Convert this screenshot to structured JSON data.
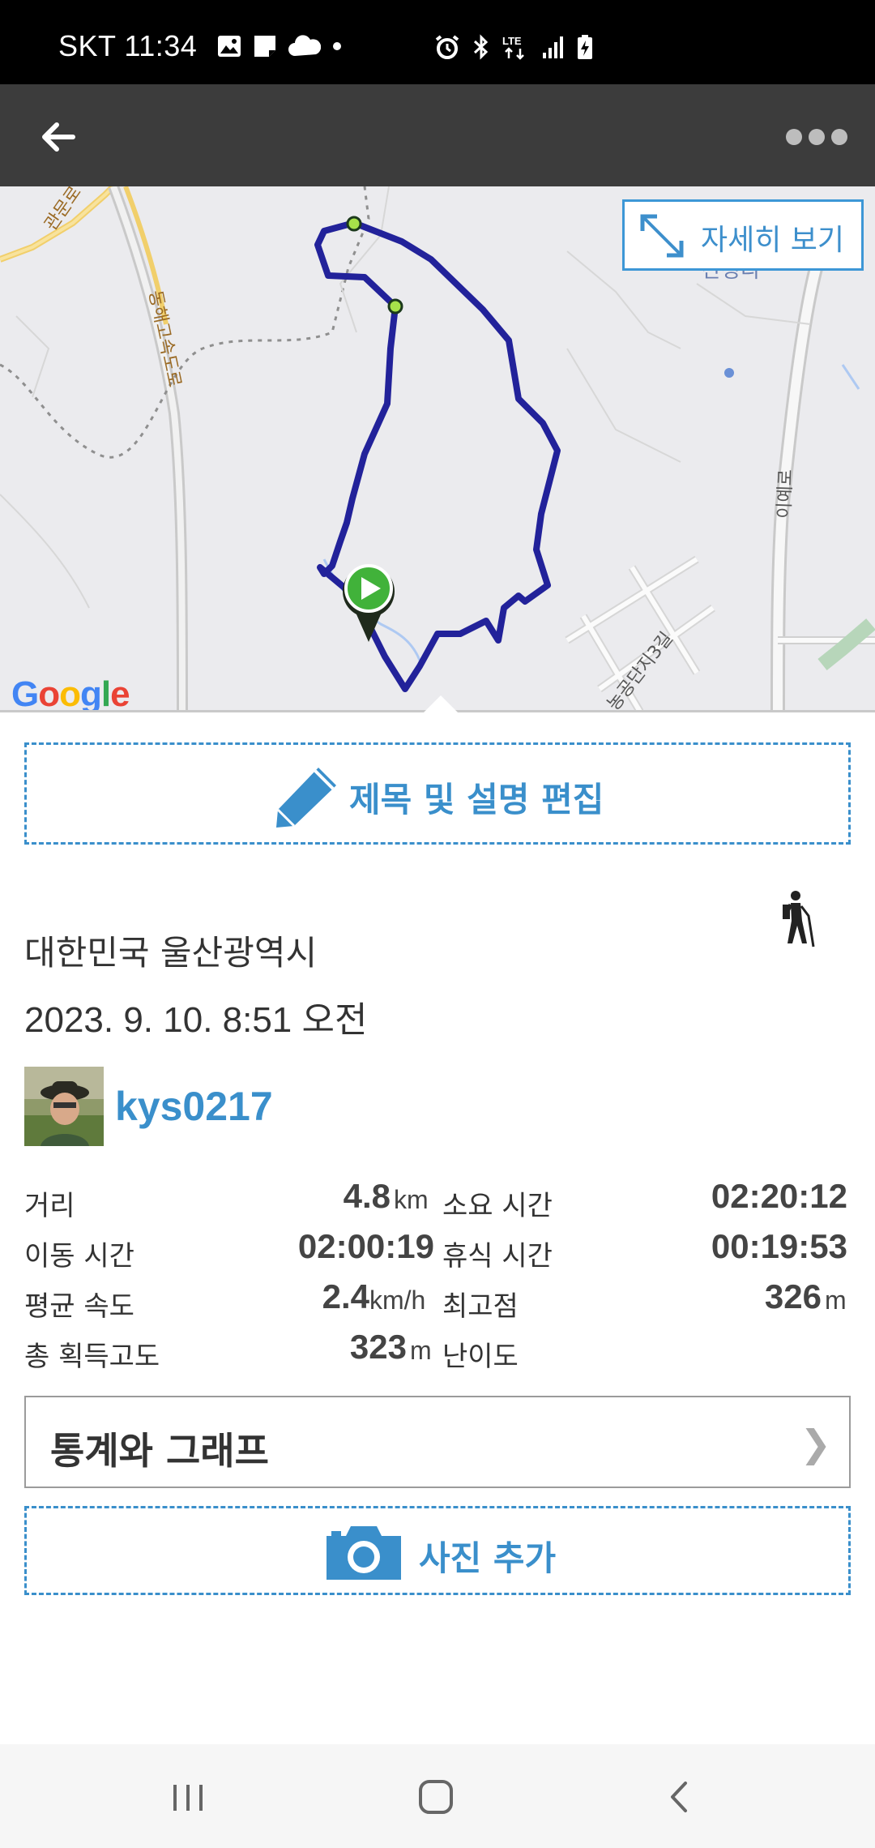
{
  "status_bar": {
    "carrier_time": "SKT 11:34",
    "left_icons": [
      "gallery-icon",
      "note-icon",
      "cloud-icon",
      "dot-icon"
    ],
    "right_icons": [
      "alarm-icon",
      "bluetooth-icon",
      "lte-icon",
      "signal-icon",
      "battery-charging-icon"
    ]
  },
  "toolbar": {
    "back_icon": "back-arrow-icon",
    "more_icon": "more-dots-icon"
  },
  "map": {
    "detail_button_label": "자세히 보기",
    "logo": "Google",
    "labels": {
      "road_1": "관문로",
      "highway": "동해고속도로",
      "road_2": "이예로",
      "road_3": "농공단지3길",
      "place_partial": "산청리"
    },
    "route_color": "#22229a"
  },
  "edit_button": {
    "label": "제목 및 설명 편집"
  },
  "activity": {
    "location": "대한민국 울산광역시",
    "datetime": "2023. 9. 10. 8:51 오전",
    "type_icon": "hiker-icon"
  },
  "user": {
    "name": "kys0217"
  },
  "stats": {
    "distance": {
      "label": "거리",
      "value": "4.8",
      "unit": "km"
    },
    "elapsed": {
      "label": "소요 시간",
      "value": "02:20:12"
    },
    "moving": {
      "label": "이동 시간",
      "value": "02:00:19"
    },
    "rest": {
      "label": "휴식 시간",
      "value": "00:19:53"
    },
    "avg_speed": {
      "label": "평균 속도",
      "value": "2.4",
      "unit": "km/h"
    },
    "max_alt": {
      "label": "최고점",
      "value": "326",
      "unit": "m"
    },
    "total_ascent": {
      "label": "총 획득고도",
      "value": "323",
      "unit": "m"
    },
    "difficulty": {
      "label": "난이도",
      "value": ""
    }
  },
  "graph_row": {
    "label": "통계와 그래프",
    "chevron": "❯"
  },
  "photo_button": {
    "label": "사진 추가"
  },
  "nav": {
    "recent": "recent-apps-icon",
    "home": "home-icon",
    "back": "nav-back-icon"
  },
  "colors": {
    "accent": "#3a8fcb",
    "toolbar": "#3c3c3c",
    "route": "#22229a",
    "start_marker": "#3aa935"
  }
}
